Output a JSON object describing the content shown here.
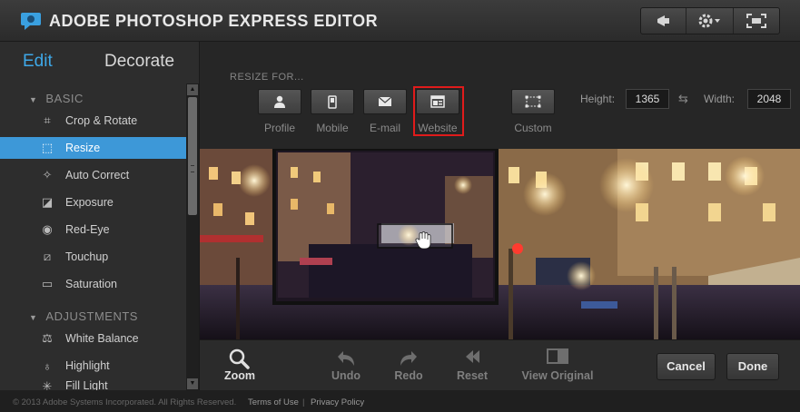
{
  "app": {
    "title": "ADOBE PHOTOSHOP EXPRESS EDITOR"
  },
  "topbar": {
    "icons": [
      "megaphone-icon",
      "gear-icon",
      "fullscreen-icon"
    ]
  },
  "sidebar": {
    "tabs": {
      "edit": "Edit",
      "decorate": "Decorate"
    },
    "sections": {
      "basic": "BASIC",
      "adjustments": "ADJUSTMENTS"
    },
    "basic_items": [
      {
        "label": "Crop & Rotate",
        "icon": "crop-icon"
      },
      {
        "label": "Resize",
        "icon": "resize-icon",
        "active": true
      },
      {
        "label": "Auto Correct",
        "icon": "magic-wand-icon"
      },
      {
        "label": "Exposure",
        "icon": "exposure-icon"
      },
      {
        "label": "Red-Eye",
        "icon": "eye-icon"
      },
      {
        "label": "Touchup",
        "icon": "bandage-icon"
      },
      {
        "label": "Saturation",
        "icon": "saturation-icon"
      }
    ],
    "adjustment_items": [
      {
        "label": "White Balance",
        "icon": "scale-icon"
      },
      {
        "label": "Highlight",
        "icon": "bulb-icon"
      },
      {
        "label": "Fill Light",
        "icon": "fill-light-icon"
      }
    ]
  },
  "resize": {
    "heading": "RESIZE FOR...",
    "presets": [
      {
        "label": "Profile",
        "icon": "person-icon"
      },
      {
        "label": "Mobile",
        "icon": "phone-icon"
      },
      {
        "label": "E-mail",
        "icon": "envelope-icon"
      },
      {
        "label": "Website",
        "icon": "webpage-icon",
        "selected": true
      },
      {
        "label": "Custom",
        "icon": "custom-frame-icon"
      }
    ],
    "height_label": "Height:",
    "height_value": "1365",
    "width_label": "Width:",
    "width_value": "2048"
  },
  "bottombar": {
    "zoom": "Zoom",
    "undo": "Undo",
    "redo": "Redo",
    "reset": "Reset",
    "view_original": "View Original",
    "cancel": "Cancel",
    "done": "Done"
  },
  "footer": {
    "copyright": "© 2013 Adobe Systems Incorporated. All Rights Reserved.",
    "terms": "Terms of Use",
    "separator": "|",
    "privacy": "Privacy Policy"
  },
  "colors": {
    "accent": "#3d98d8",
    "highlight_box": "#e01b1b"
  }
}
